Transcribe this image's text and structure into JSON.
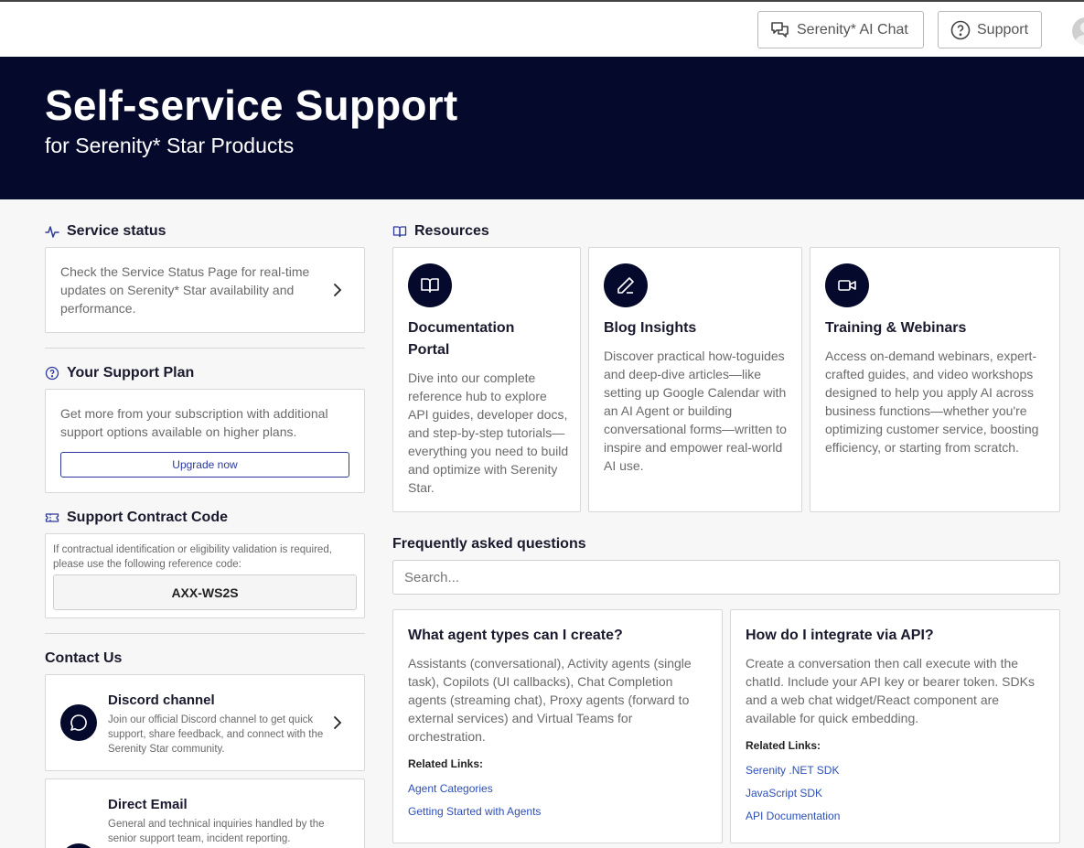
{
  "topbar": {
    "chat_label": "Serenity* AI Chat",
    "support_label": "Support"
  },
  "hero": {
    "title": "Self-service Support",
    "subtitle": "for Serenity* Star Products"
  },
  "service_status": {
    "heading": "Service status",
    "text": "Check the Service Status Page for real-time updates on Serenity* Star availability and performance."
  },
  "support_plan": {
    "heading": "Your Support Plan",
    "text": "Get more from your subscription with additional support options available on higher plans.",
    "button": "Upgrade now"
  },
  "contract": {
    "heading": "Support Contract Code",
    "text": "If contractual identification or eligibility validation is required, please use the following reference code:",
    "code": "AXX-WS2S"
  },
  "contact": {
    "heading": "Contact Us",
    "discord": {
      "title": "Discord channel",
      "text": "Join our official Discord channel to get quick support, share feedback, and connect with the Serenity Star community."
    },
    "email": {
      "title": "Direct Email",
      "text": "General and technical inquiries handled by the senior support team, incident reporting."
    }
  },
  "resources": {
    "heading": "Resources",
    "items": [
      {
        "title_line1": "Documentation",
        "title_line2": "Portal",
        "body": "Dive into our complete reference hub to explore API guides, developer docs, and step-by-step tutorials—everything you need to build and optimize with Serenity Star.",
        "icon": "book-icon"
      },
      {
        "title": "Blog Insights",
        "body": "Discover practical how-toguides and deep-dive articles—like setting up Google Calendar with an AI Agent or building conversational forms—written to inspire and empower real-world AI use.",
        "icon": "pencil-icon"
      },
      {
        "title": "Training & Webinars",
        "body": "Access on-demand webinars, expert-crafted guides, and video workshops designed to help you apply AI across business functions—whether you're optimizing customer service, boosting efficiency, or starting from scratch.",
        "icon": "video-icon"
      }
    ]
  },
  "faq": {
    "heading": "Frequently asked questions",
    "search_placeholder": "Search...",
    "related_label": "Related Links:",
    "items": [
      {
        "question": "What agent types can I create?",
        "answer": "Assistants (conversational), Activity agents (single task), Copilots (UI callbacks), Chat Completion agents (streaming chat), Proxy agents (forward to external services) and Virtual Teams for orchestration.",
        "links": [
          "Agent Categories",
          "Getting Started with Agents"
        ]
      },
      {
        "question": "How do I integrate via API?",
        "answer": "Create a conversation then call execute with the chatId. Include your API key or bearer token. SDKs and a web chat widget/React component are available for quick embedding.",
        "links": [
          "Serenity .NET SDK",
          "JavaScript SDK",
          "API Documentation"
        ]
      }
    ]
  },
  "colors": {
    "navy": "#050a2c",
    "accent": "#2d3a9c",
    "link": "#2d4fb8"
  }
}
